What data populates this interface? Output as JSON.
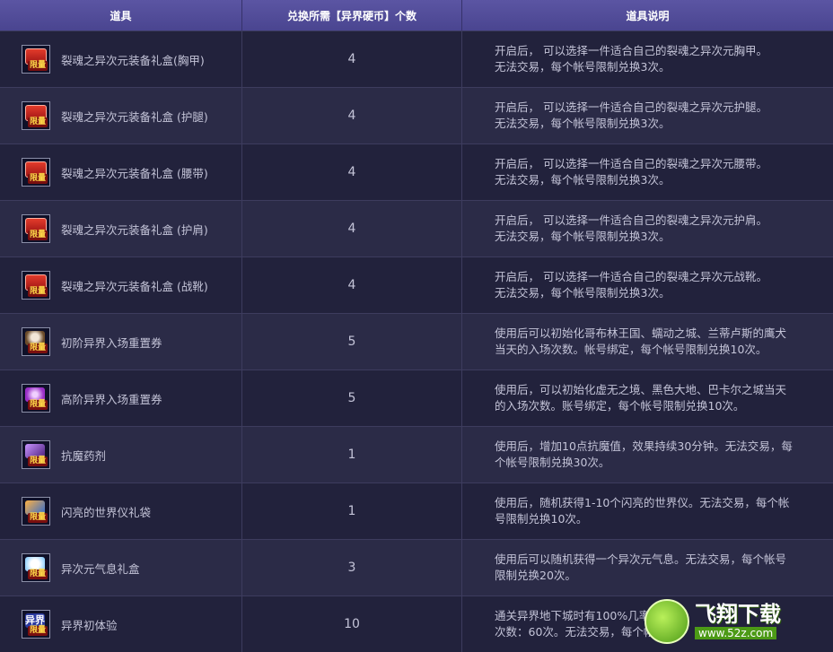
{
  "header": {
    "col_item": "道具",
    "col_cost": "兑换所需【异界硬币】个数",
    "col_desc": "道具说明"
  },
  "rows": [
    {
      "name": "裂魂之异次元装备礼盒(胸甲)",
      "qty": "4",
      "desc1": "开启后， 可以选择一件适合自己的裂魂之异次元胸甲。",
      "desc2": "无法交易，每个帐号限制兑换3次。",
      "icon": "red-giftbox-icon",
      "badge": "限量"
    },
    {
      "name": "裂魂之异次元装备礼盒 (护腿)",
      "qty": "4",
      "desc1": "开启后， 可以选择一件适合自己的裂魂之异次元护腿。",
      "desc2": "无法交易，每个帐号限制兑换3次。",
      "icon": "red-giftbox-icon",
      "badge": "限量"
    },
    {
      "name": "裂魂之异次元装备礼盒 (腰带)",
      "qty": "4",
      "desc1": "开启后， 可以选择一件适合自己的裂魂之异次元腰带。",
      "desc2": "无法交易，每个帐号限制兑换3次。",
      "icon": "red-giftbox-icon",
      "badge": "限量"
    },
    {
      "name": "裂魂之异次元装备礼盒 (护肩)",
      "qty": "4",
      "desc1": "开启后， 可以选择一件适合自己的裂魂之异次元护肩。",
      "desc2": "无法交易，每个帐号限制兑换3次。",
      "icon": "red-giftbox-icon",
      "badge": "限量"
    },
    {
      "name": "裂魂之异次元装备礼盒 (战靴)",
      "qty": "4",
      "desc1": "开启后， 可以选择一件适合自己的裂魂之异次元战靴。",
      "desc2": "无法交易，每个帐号限制兑换3次。",
      "icon": "red-giftbox-icon",
      "badge": "限量"
    },
    {
      "name": "初阶异界入场重置券",
      "qty": "5",
      "desc1": "使用后可以初始化哥布林王国、蠕动之城、兰蒂卢斯的鹰犬",
      "desc2": "当天的入场次数。帐号绑定，每个帐号限制兑换10次。",
      "icon": "skull-ticket-icon",
      "badge": "限量"
    },
    {
      "name": "高阶异界入场重置券",
      "qty": "5",
      "desc1": "使用后，可以初始化虚无之境、黑色大地、巴卡尔之城当天",
      "desc2": "的入场次数。账号绑定，每个帐号限制兑换10次。",
      "icon": "purple-ticket-icon",
      "badge": "限量"
    },
    {
      "name": "抗魔药剂",
      "qty": "1",
      "desc1": "使用后，增加10点抗魔值，效果持续30分钟。无法交易，每",
      "desc2": "个帐号限制兑换30次。",
      "icon": "potion-icon",
      "badge": "限量"
    },
    {
      "name": "闪亮的世界仪礼袋",
      "qty": "1",
      "desc1": "使用后，随机获得1-10个闪亮的世界仪。无法交易，每个帐",
      "desc2": "号限制兑换10次。",
      "icon": "gift-bag-icon",
      "badge": "限量"
    },
    {
      "name": "异次元气息礼盒",
      "qty": "3",
      "desc1": "使用后可以随机获得一个异次元气息。无法交易，每个帐号",
      "desc2": "限制兑换20次。",
      "icon": "cloud-box-icon",
      "badge": "限量"
    },
    {
      "name": "异界初体验",
      "qty": "10",
      "desc1": "通关异界地下城时有100%几率获",
      "desc2": "次数：60次。无法交易，每个帐",
      "icon": "text-badge-icon",
      "badge": "限量",
      "icon_text": "异界"
    }
  ],
  "watermark": {
    "main": "飞翔下载",
    "sub": "www.52z.com"
  }
}
